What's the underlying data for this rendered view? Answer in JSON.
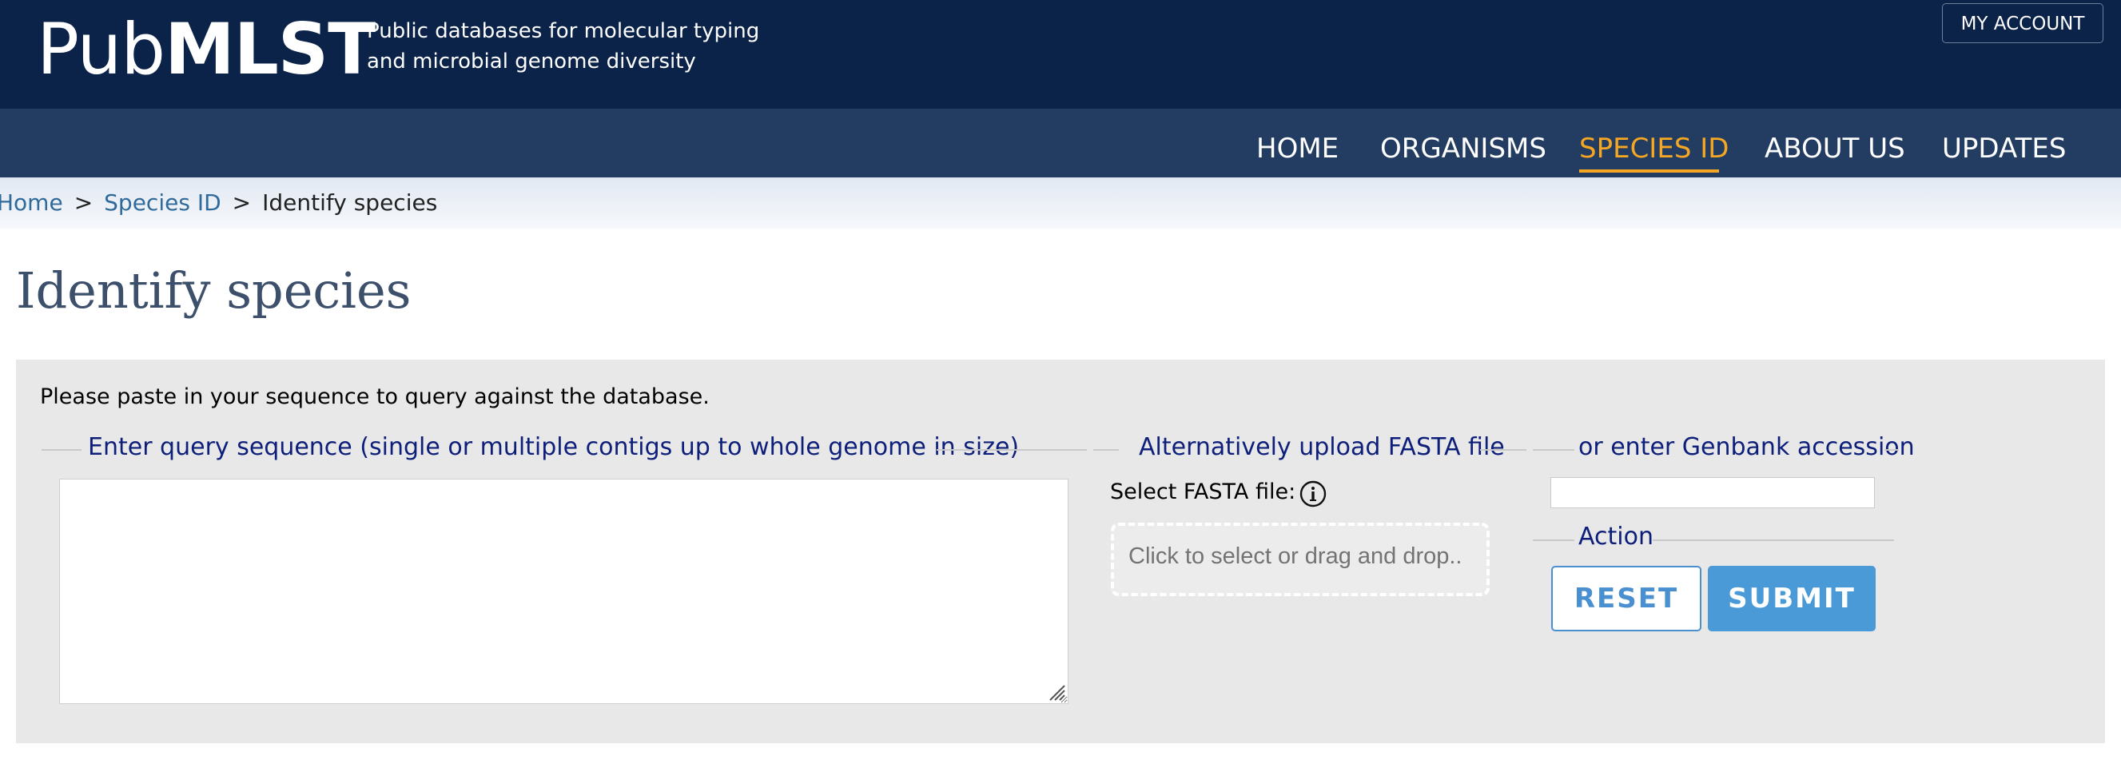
{
  "header": {
    "logo_light": "Pub",
    "logo_bold": "MLST",
    "tagline_line1": "Public databases for molecular typing",
    "tagline_line2": "and microbial genome diversity",
    "account_label": "MY ACCOUNT"
  },
  "nav": {
    "items": [
      {
        "label": "HOME",
        "active": false
      },
      {
        "label": "ORGANISMS",
        "active": false
      },
      {
        "label": "SPECIES ID",
        "active": true
      },
      {
        "label": "ABOUT US",
        "active": false
      },
      {
        "label": "UPDATES",
        "active": false
      }
    ],
    "active_color": "#f5a623"
  },
  "breadcrumb": {
    "items": [
      "Home",
      "Species ID",
      "Identify species"
    ],
    "separator": ">"
  },
  "page": {
    "title": "Identify species",
    "intro": "Please paste in your sequence to query against the database."
  },
  "form": {
    "query_legend": "Enter query sequence (single or multiple contigs up to whole genome in size)",
    "query_value": "",
    "upload_legend": "Alternatively upload FASTA file",
    "fasta_label": "Select FASTA file:",
    "dropzone_text": "Click to select or drag and drop..",
    "accession_legend": "or enter Genbank accession",
    "accession_value": "",
    "action_legend": "Action",
    "reset_label": "RESET",
    "submit_label": "SUBMIT"
  },
  "colors": {
    "header_bg": "#0b2249",
    "nav_bg": "#233c61",
    "link": "#2f6a9b",
    "legend_text": "#0d1f7a",
    "button_blue": "#4a9ad8"
  }
}
